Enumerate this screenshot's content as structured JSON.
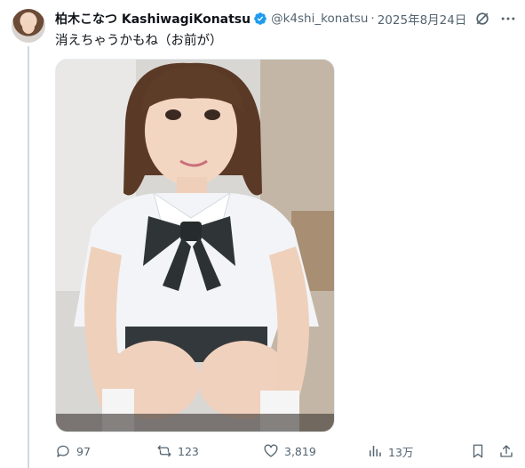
{
  "tweet": {
    "display_name": "柏木こなつ KashiwagiKonatsu",
    "handle": "@k4shi_konatsu",
    "separator": "·",
    "date": "2025年8月24日",
    "text": "消えちゃうかもね（お前が）",
    "media_alt_icon": "photo"
  },
  "actions": {
    "replies": "97",
    "reposts": "123",
    "likes": "3,819",
    "views": "13万"
  },
  "colors": {
    "verified": "#1d9bf0",
    "muted": "#536471",
    "text": "#0f1419",
    "line": "#cfd9de"
  }
}
